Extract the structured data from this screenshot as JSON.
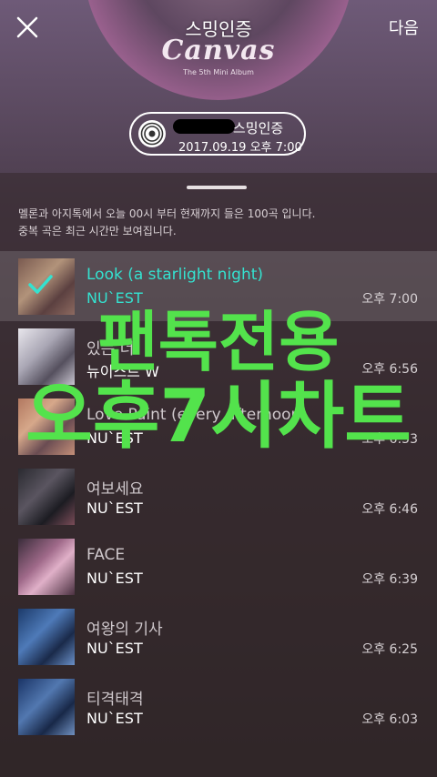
{
  "header": {
    "title": "스밍인증",
    "next_label": "다음",
    "album_title": "Canvas",
    "album_subtitle": "The 5th Mini Album"
  },
  "cert": {
    "label": "스밍인증",
    "datetime": "2017.09.19 오후 7:00"
  },
  "info": {
    "line1": "멜론과 아지톡에서 오늘 00시 부터 현재까지 들은 100곡 입니다.",
    "line2": "중복 곡은 최근 시간만 보여집니다."
  },
  "songs": [
    {
      "title": "Look (a starlight night)",
      "artist": "NU`EST",
      "time": "오후 7:00",
      "selected": true
    },
    {
      "title": "있는 너",
      "artist": "뉴이스트 W",
      "time": "오후 6:56",
      "selected": false
    },
    {
      "title": "Love Paint (every afternoon)",
      "artist": "NU`EST",
      "time": "오후 6:53",
      "selected": false
    },
    {
      "title": "여보세요",
      "artist": "NU`EST",
      "time": "오후 6:46",
      "selected": false
    },
    {
      "title": "FACE",
      "artist": "NU`EST",
      "time": "오후 6:39",
      "selected": false
    },
    {
      "title": "여왕의 기사",
      "artist": "NU`EST",
      "time": "오후 6:25",
      "selected": false
    },
    {
      "title": "티격태격",
      "artist": "NU`EST",
      "time": "오후 6:03",
      "selected": false
    }
  ],
  "overlay": {
    "line1": "팬톡전용",
    "line2": "오후7시차트"
  },
  "colors": {
    "accent_teal": "#34e2d0",
    "overlay_green": "#53e34c"
  }
}
